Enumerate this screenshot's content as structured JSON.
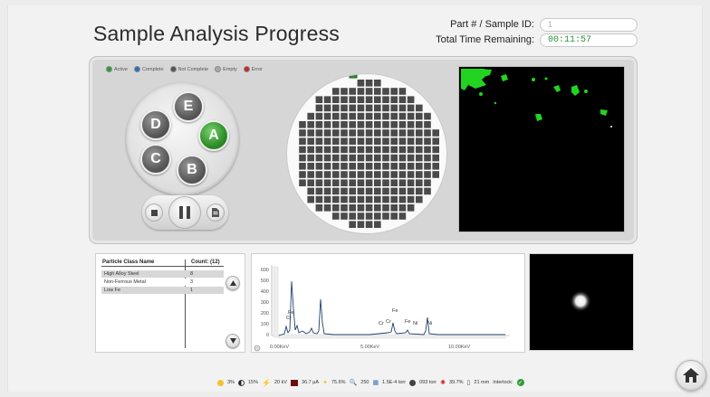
{
  "header": {
    "title": "Sample Analysis Progress",
    "part_label": "Part # / Sample ID:",
    "part_value": "1",
    "time_label": "Total Time Remaining:",
    "time_value": "00:11:57"
  },
  "legend": [
    {
      "label": "Active",
      "color": "#2f9e3a"
    },
    {
      "label": "Complete",
      "color": "#2b6fc2"
    },
    {
      "label": "Not Complete",
      "color": "#555555"
    },
    {
      "label": "Empty",
      "color": "#a8a8a8"
    },
    {
      "label": "Error",
      "color": "#d62020"
    }
  ],
  "carousel": {
    "slots": [
      "A",
      "B",
      "C",
      "D",
      "E"
    ],
    "active_slot": "A"
  },
  "particles": {
    "header_name": "Particle Class Name",
    "header_count": "Count: (12)",
    "rows": [
      {
        "name": "High Alloy Steel",
        "count": "8"
      },
      {
        "name": "Non-Ferrous Metal",
        "count": "3"
      },
      {
        "name": "Low Fe",
        "count": "1"
      }
    ]
  },
  "spectrum": {
    "y_ticks": [
      "600",
      "500",
      "400",
      "300",
      "200",
      "100",
      "0"
    ],
    "x_ticks": [
      "0.00KeV",
      "5.00KeV",
      "10.00KeV"
    ],
    "peak_labels": [
      "Fe",
      "Cr",
      "Cr",
      "Cr",
      "Fe",
      "Fe",
      "Ni",
      "Ni"
    ]
  },
  "status": [
    {
      "icon": "brightness-icon",
      "value": "3%"
    },
    {
      "icon": "contrast-icon",
      "value": "15%"
    },
    {
      "icon": "voltage-icon",
      "value": "20 kV"
    },
    {
      "icon": "current-icon",
      "value": "36.7 µA"
    },
    {
      "icon": "spot-icon",
      "value": "75.6%"
    },
    {
      "icon": "magnification-icon",
      "value": "250"
    },
    {
      "icon": "vacuum-icon",
      "value": "1.5E-4 torr"
    },
    {
      "icon": "pressure-icon",
      "value": "093 torr"
    },
    {
      "icon": "filament-icon",
      "value": "39.7%"
    },
    {
      "icon": "distance-icon",
      "value": "21 mm"
    },
    {
      "icon": "interlock-icon",
      "value": "Interlock:"
    }
  ]
}
